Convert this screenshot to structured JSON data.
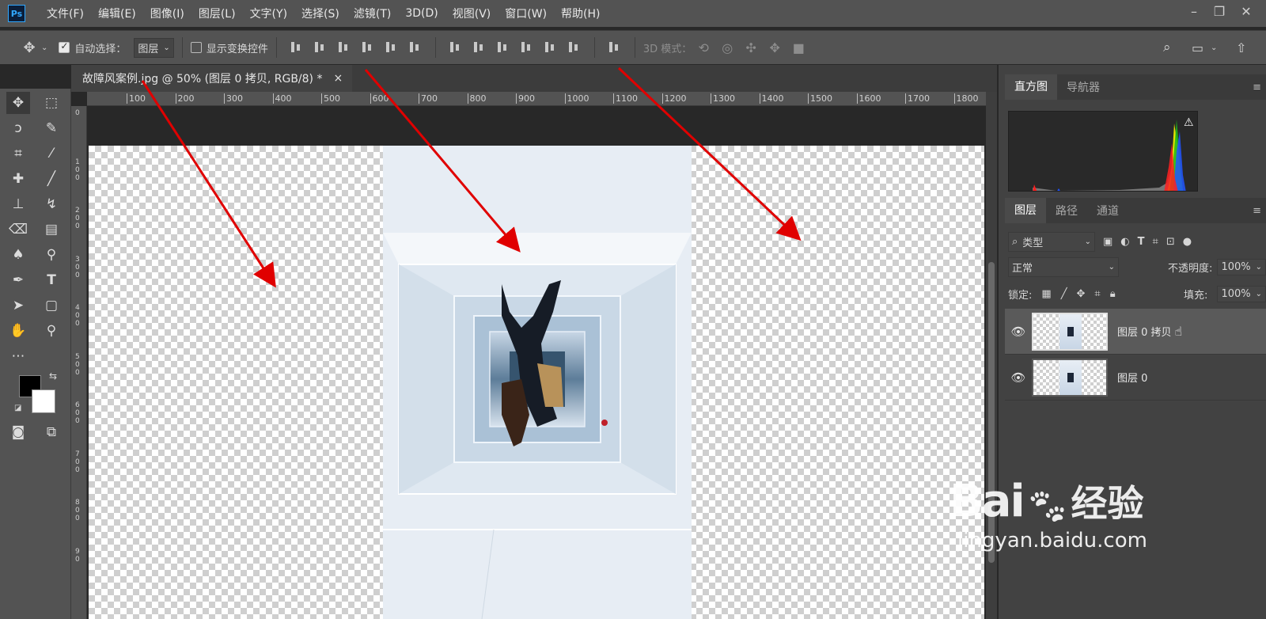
{
  "app": {
    "logo": "Ps"
  },
  "menu": [
    "文件(F)",
    "编辑(E)",
    "图像(I)",
    "图层(L)",
    "文字(Y)",
    "选择(S)",
    "滤镜(T)",
    "3D(D)",
    "视图(V)",
    "窗口(W)",
    "帮助(H)"
  ],
  "options": {
    "auto_select_label": "自动选择：",
    "auto_select_value": "图层",
    "show_transform_label": "显示变换控件",
    "mode_3d_label": "3D 模式："
  },
  "document": {
    "tab_title": "故障风案例.jpg @ 50% (图层 0 拷贝, RGB/8) *",
    "close": "×"
  },
  "ruler_top": [
    "100",
    "200",
    "300",
    "400",
    "500",
    "600",
    "700",
    "800",
    "900",
    "1000",
    "1100",
    "1200",
    "1300",
    "1400",
    "1500",
    "1600",
    "1700",
    "1800"
  ],
  "ruler_left": [
    "0",
    "1\n0\n0",
    "2\n0\n0",
    "3\n0\n0",
    "4\n0\n0",
    "5\n0\n0",
    "6\n0\n0",
    "7\n0\n0",
    "8\n0\n0",
    "9\n0"
  ],
  "panel_top": {
    "tabs": [
      "直方图",
      "导航器"
    ],
    "warning": "⚠"
  },
  "layers_panel": {
    "tabs": [
      "图层",
      "路径",
      "通道"
    ],
    "filter_label": "类型",
    "blend_mode": "正常",
    "opacity_label": "不透明度:",
    "opacity_value": "100%",
    "lock_label": "锁定:",
    "fill_label": "填充:",
    "fill_value": "100%",
    "layers": [
      {
        "name": "图层 0 拷贝",
        "visible": true,
        "selected": true
      },
      {
        "name": "图层 0",
        "visible": true,
        "selected": false
      }
    ]
  },
  "watermark": {
    "brand": "Bai",
    "brand2": "经验",
    "url": "jingyan.baidu.com"
  },
  "colors": {
    "accent": "#31a8ff",
    "arrow": "#e00000"
  }
}
